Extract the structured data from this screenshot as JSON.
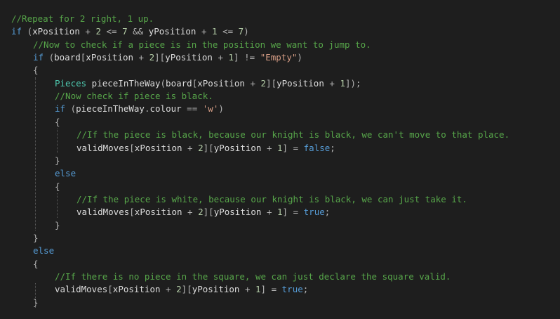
{
  "editor": {
    "lines": [
      {
        "indent": 0,
        "tokens": [
          {
            "t": "comment",
            "v": "//Repeat for 2 right, 1 up."
          }
        ]
      },
      {
        "indent": 0,
        "tokens": [
          {
            "t": "keyword",
            "v": "if"
          },
          {
            "t": "punct",
            "v": " ("
          },
          {
            "t": "ident",
            "v": "xPosition"
          },
          {
            "t": "op",
            "v": " + "
          },
          {
            "t": "number",
            "v": "2"
          },
          {
            "t": "op",
            "v": " <= "
          },
          {
            "t": "number",
            "v": "7"
          },
          {
            "t": "op",
            "v": " && "
          },
          {
            "t": "ident",
            "v": "yPosition"
          },
          {
            "t": "op",
            "v": " + "
          },
          {
            "t": "number",
            "v": "1"
          },
          {
            "t": "op",
            "v": " <= "
          },
          {
            "t": "number",
            "v": "7"
          },
          {
            "t": "punct",
            "v": ")"
          }
        ]
      },
      {
        "indent": 1,
        "tokens": [
          {
            "t": "comment",
            "v": "//Now to check if a piece is in the position we want to jump to."
          }
        ]
      },
      {
        "indent": 1,
        "tokens": [
          {
            "t": "keyword",
            "v": "if"
          },
          {
            "t": "punct",
            "v": " ("
          },
          {
            "t": "ident",
            "v": "board"
          },
          {
            "t": "punct",
            "v": "["
          },
          {
            "t": "ident",
            "v": "xPosition"
          },
          {
            "t": "op",
            "v": " + "
          },
          {
            "t": "number",
            "v": "2"
          },
          {
            "t": "punct",
            "v": "]["
          },
          {
            "t": "ident",
            "v": "yPosition"
          },
          {
            "t": "op",
            "v": " + "
          },
          {
            "t": "number",
            "v": "1"
          },
          {
            "t": "punct",
            "v": "]"
          },
          {
            "t": "op",
            "v": " != "
          },
          {
            "t": "string",
            "v": "\"Empty\""
          },
          {
            "t": "punct",
            "v": ")"
          }
        ]
      },
      {
        "indent": 1,
        "tokens": [
          {
            "t": "punct",
            "v": "{"
          }
        ]
      },
      {
        "indent": 2,
        "tokens": [
          {
            "t": "type",
            "v": "Pieces"
          },
          {
            "t": "ident",
            "v": " pieceInTheWay"
          },
          {
            "t": "punct",
            "v": "("
          },
          {
            "t": "ident",
            "v": "board"
          },
          {
            "t": "punct",
            "v": "["
          },
          {
            "t": "ident",
            "v": "xPosition"
          },
          {
            "t": "op",
            "v": " + "
          },
          {
            "t": "number",
            "v": "2"
          },
          {
            "t": "punct",
            "v": "]["
          },
          {
            "t": "ident",
            "v": "yPosition"
          },
          {
            "t": "op",
            "v": " + "
          },
          {
            "t": "number",
            "v": "1"
          },
          {
            "t": "punct",
            "v": "]);"
          }
        ]
      },
      {
        "indent": 2,
        "tokens": [
          {
            "t": "comment",
            "v": "//Now check if piece is black."
          }
        ]
      },
      {
        "indent": 2,
        "tokens": [
          {
            "t": "keyword",
            "v": "if"
          },
          {
            "t": "punct",
            "v": " ("
          },
          {
            "t": "ident",
            "v": "pieceInTheWay"
          },
          {
            "t": "punct",
            "v": "."
          },
          {
            "t": "ident",
            "v": "colour"
          },
          {
            "t": "op",
            "v": " == "
          },
          {
            "t": "string",
            "v": "'w'"
          },
          {
            "t": "punct",
            "v": ")"
          }
        ]
      },
      {
        "indent": 2,
        "tokens": [
          {
            "t": "punct",
            "v": "{"
          }
        ]
      },
      {
        "indent": 3,
        "tokens": [
          {
            "t": "comment",
            "v": "//If the piece is black, because our knight is black, we can't move to that place."
          }
        ]
      },
      {
        "indent": 3,
        "tokens": [
          {
            "t": "ident",
            "v": "validMoves"
          },
          {
            "t": "punct",
            "v": "["
          },
          {
            "t": "ident",
            "v": "xPosition"
          },
          {
            "t": "op",
            "v": " + "
          },
          {
            "t": "number",
            "v": "2"
          },
          {
            "t": "punct",
            "v": "]["
          },
          {
            "t": "ident",
            "v": "yPosition"
          },
          {
            "t": "op",
            "v": " + "
          },
          {
            "t": "number",
            "v": "1"
          },
          {
            "t": "punct",
            "v": "]"
          },
          {
            "t": "op",
            "v": " = "
          },
          {
            "t": "keyword",
            "v": "false"
          },
          {
            "t": "punct",
            "v": ";"
          }
        ]
      },
      {
        "indent": 2,
        "tokens": [
          {
            "t": "punct",
            "v": "}"
          }
        ]
      },
      {
        "indent": 2,
        "tokens": [
          {
            "t": "keyword",
            "v": "else"
          }
        ]
      },
      {
        "indent": 2,
        "tokens": [
          {
            "t": "punct",
            "v": "{"
          }
        ]
      },
      {
        "indent": 3,
        "tokens": [
          {
            "t": "comment",
            "v": "//If the piece is white, because our knight is black, we can just take it."
          }
        ]
      },
      {
        "indent": 3,
        "tokens": [
          {
            "t": "ident",
            "v": "validMoves"
          },
          {
            "t": "punct",
            "v": "["
          },
          {
            "t": "ident",
            "v": "xPosition"
          },
          {
            "t": "op",
            "v": " + "
          },
          {
            "t": "number",
            "v": "2"
          },
          {
            "t": "punct",
            "v": "]["
          },
          {
            "t": "ident",
            "v": "yPosition"
          },
          {
            "t": "op",
            "v": " + "
          },
          {
            "t": "number",
            "v": "1"
          },
          {
            "t": "punct",
            "v": "]"
          },
          {
            "t": "op",
            "v": " = "
          },
          {
            "t": "keyword",
            "v": "true"
          },
          {
            "t": "punct",
            "v": ";"
          }
        ]
      },
      {
        "indent": 2,
        "tokens": [
          {
            "t": "punct",
            "v": "}"
          }
        ]
      },
      {
        "indent": 1,
        "tokens": [
          {
            "t": "punct",
            "v": "}"
          }
        ]
      },
      {
        "indent": 1,
        "tokens": [
          {
            "t": "keyword",
            "v": "else"
          }
        ]
      },
      {
        "indent": 1,
        "tokens": [
          {
            "t": "punct",
            "v": "{"
          }
        ]
      },
      {
        "indent": 2,
        "tokens": [
          {
            "t": "comment",
            "v": "//If there is no piece in the square, we can just declare the square valid."
          }
        ]
      },
      {
        "indent": 2,
        "tokens": [
          {
            "t": "ident",
            "v": "validMoves"
          },
          {
            "t": "punct",
            "v": "["
          },
          {
            "t": "ident",
            "v": "xPosition"
          },
          {
            "t": "op",
            "v": " + "
          },
          {
            "t": "number",
            "v": "2"
          },
          {
            "t": "punct",
            "v": "]["
          },
          {
            "t": "ident",
            "v": "yPosition"
          },
          {
            "t": "op",
            "v": " + "
          },
          {
            "t": "number",
            "v": "1"
          },
          {
            "t": "punct",
            "v": "]"
          },
          {
            "t": "op",
            "v": " = "
          },
          {
            "t": "keyword",
            "v": "true"
          },
          {
            "t": "punct",
            "v": ";"
          }
        ]
      },
      {
        "indent": 1,
        "tokens": [
          {
            "t": "punct",
            "v": "}"
          }
        ]
      }
    ]
  },
  "colors": {
    "background": "#1e1e1e",
    "keyword": "#569cd6",
    "comment": "#57a64a",
    "type": "#4ec9b0",
    "string": "#d69d85",
    "number": "#b5cea8",
    "identifier": "#dcdcdc",
    "punctuation": "#b4b4b4",
    "indent_guide": "#5a5a5a"
  }
}
